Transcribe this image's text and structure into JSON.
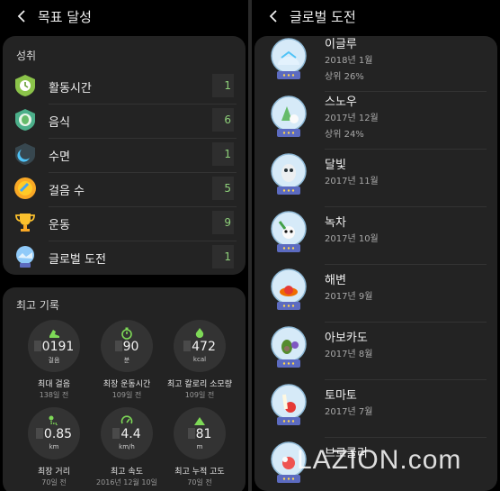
{
  "colors": {
    "accent_green": "#8ed07a",
    "card_bg": "#232323",
    "panel_bg": "#000000"
  },
  "left": {
    "header_title": "목표 달성",
    "achievements": {
      "title": "성취",
      "items": [
        {
          "label": "활동시간",
          "count": "1",
          "icon": "activity-time-icon"
        },
        {
          "label": "음식",
          "count": "6",
          "icon": "food-shield-icon"
        },
        {
          "label": "수면",
          "count": "1",
          "icon": "sleep-moon-icon"
        },
        {
          "label": "걸음 수",
          "count": "5",
          "icon": "steps-medal-icon"
        },
        {
          "label": "운동",
          "count": "9",
          "icon": "trophy-icon"
        },
        {
          "label": "글로벌 도전",
          "count": "1",
          "icon": "global-challenge-globe-icon"
        }
      ]
    },
    "records": {
      "title": "최고 기록",
      "items": [
        {
          "value": "0191",
          "unit": "걸음",
          "label": "최대 걸음",
          "sub": "138일 전",
          "icon": "shoe-icon"
        },
        {
          "value": "90",
          "unit": "분",
          "label": "최장 운동시간",
          "sub": "109일 전",
          "icon": "stopwatch-icon"
        },
        {
          "value": "472",
          "unit": "kcal",
          "label": "최고 칼로리 소모량",
          "sub": "109일 전",
          "icon": "flame-icon"
        },
        {
          "value": "0.85",
          "unit": "km",
          "label": "최장 거리",
          "sub": "70일 전",
          "icon": "route-pin-icon"
        },
        {
          "value": "4.4",
          "unit": "km/h",
          "label": "최고 속도",
          "sub": "2016년 12월 10일",
          "icon": "speedometer-icon"
        },
        {
          "value": "81",
          "unit": "m",
          "label": "최고 누적 고도",
          "sub": "70일 전",
          "icon": "mountain-icon"
        }
      ]
    }
  },
  "right": {
    "header_title": "글로벌 도전",
    "challenges": [
      {
        "name": "이글루",
        "date": "2018년 1월",
        "rank": "상위 26%",
        "icon": "igloo-globe-icon"
      },
      {
        "name": "스노우",
        "date": "2017년 12월",
        "rank": "상위 24%",
        "icon": "snow-globe-icon"
      },
      {
        "name": "달빛",
        "date": "2017년 11월",
        "rank": "",
        "icon": "owl-moon-globe-icon"
      },
      {
        "name": "녹차",
        "date": "2017년 10월",
        "rank": "",
        "icon": "panda-tea-globe-icon"
      },
      {
        "name": "해변",
        "date": "2017년 9월",
        "rank": "",
        "icon": "beach-crab-globe-icon"
      },
      {
        "name": "아보카도",
        "date": "2017년 8월",
        "rank": "",
        "icon": "avocado-globe-icon"
      },
      {
        "name": "토마토",
        "date": "2017년 7월",
        "rank": "",
        "icon": "tomato-globe-icon"
      },
      {
        "name": "브로콜리",
        "date": "",
        "rank": "",
        "icon": "broccoli-globe-icon"
      }
    ]
  },
  "watermark": "LAZION.com"
}
